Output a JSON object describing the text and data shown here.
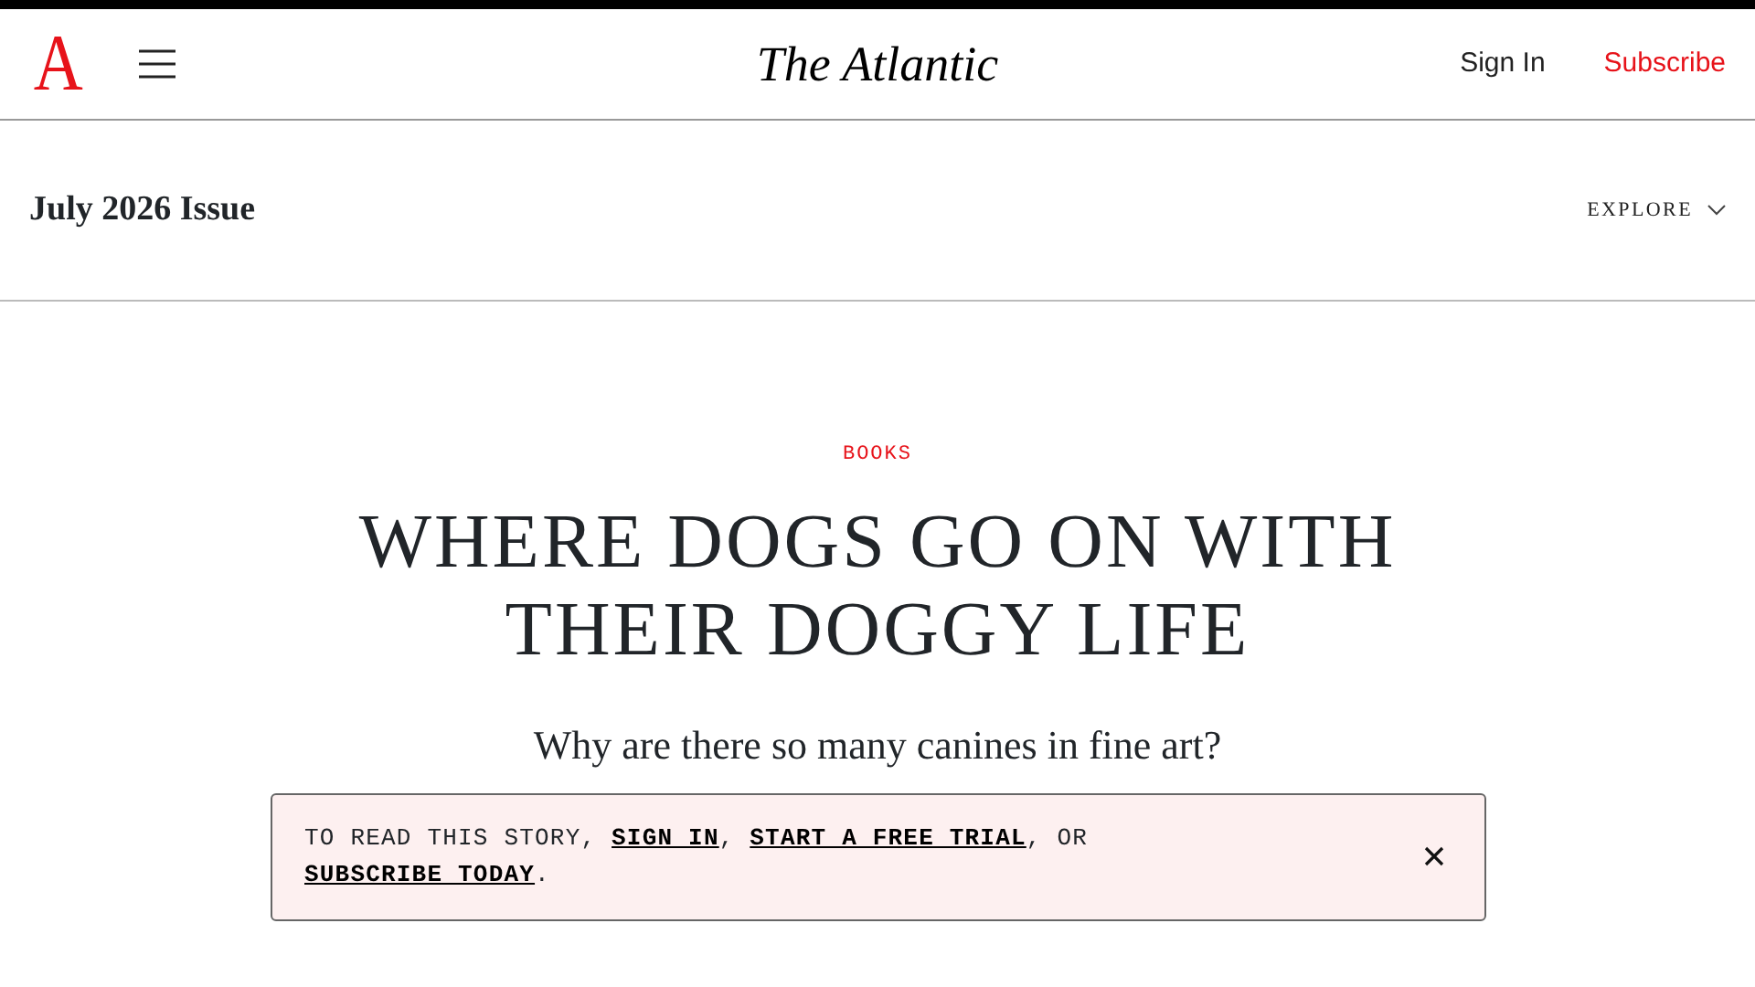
{
  "header": {
    "logo_letter": "A",
    "wordmark": "The Atlantic",
    "sign_in": "Sign In",
    "subscribe": "Subscribe"
  },
  "issue_bar": {
    "title": "July 2026 Issue",
    "explore": "EXPLORE"
  },
  "article": {
    "section": "BOOKS",
    "headline": "WHERE DOGS GO ON WITH THEIR DOGGY LIFE",
    "dek": "Why are there so many canines in fine art?"
  },
  "notice": {
    "parts": [
      {
        "kind": "text",
        "text": "TO READ THIS STORY, "
      },
      {
        "kind": "link",
        "text": "SIGN IN"
      },
      {
        "kind": "text",
        "text": ", "
      },
      {
        "kind": "link",
        "text": "START A FREE TRIAL"
      },
      {
        "kind": "text",
        "text": ", OR "
      },
      {
        "kind": "link",
        "text": "SUBSCRIBE TODAY"
      },
      {
        "kind": "text",
        "text": "."
      }
    ]
  }
}
